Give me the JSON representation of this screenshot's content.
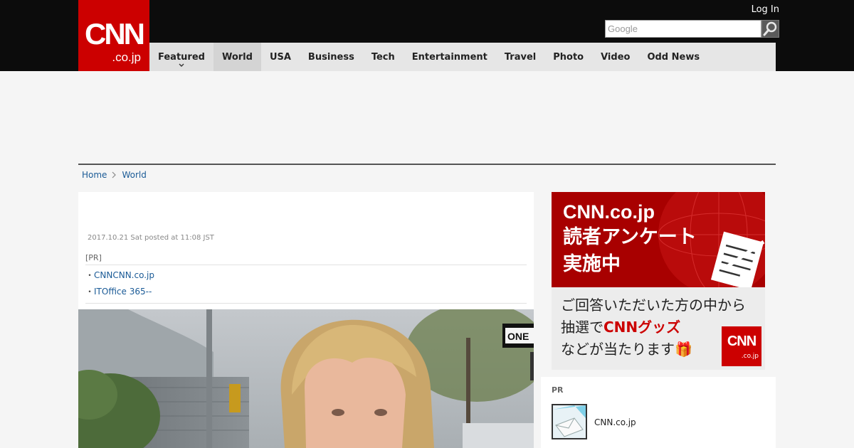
{
  "logo": {
    "main": "CNN",
    "sub": ".co.jp"
  },
  "header": {
    "login_label": "Log In",
    "search_placeholder": "Google"
  },
  "nav": {
    "items": [
      {
        "label": "Featured",
        "has_dropdown": true
      },
      {
        "label": "World",
        "active": true
      },
      {
        "label": "USA"
      },
      {
        "label": "Business"
      },
      {
        "label": "Tech"
      },
      {
        "label": "Entertainment"
      },
      {
        "label": "Travel"
      },
      {
        "label": "Photo"
      },
      {
        "label": "Video"
      },
      {
        "label": "Odd News"
      }
    ]
  },
  "breadcrumb": {
    "home": "Home",
    "current": "World"
  },
  "article": {
    "date": "2017.10.21 Sat posted at 11:08 JST",
    "pr_label": "[PR]",
    "pr_links": [
      "CNNCNN.co.jp",
      "ITOffice 365--"
    ]
  },
  "banner": {
    "line1": "CNN.co.jp",
    "line2": "読者アンケート",
    "line3": "実施中",
    "line4": "ご回答いただいた方の中から",
    "line5_prefix": "抽選で",
    "line5_highlight": "CNNグッズ",
    "line6": "などが当たります🎁",
    "logo_main": "CNN",
    "logo_sub": ".co.jp"
  },
  "sidebar_pr": {
    "label": "PR",
    "item_name": "CNN.co.jp"
  },
  "colors": {
    "brand_red": "#cc0000",
    "topbar": "#0c0c0c",
    "nav_bg": "#e6e6e6",
    "link": "#1a5a96"
  }
}
